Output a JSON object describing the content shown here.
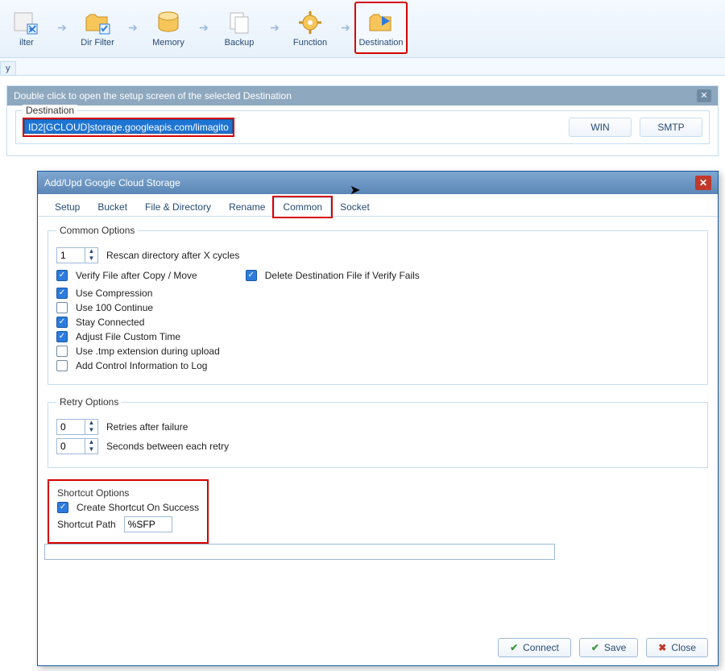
{
  "toolbar": {
    "items": [
      {
        "label": "ilter",
        "name": "filter"
      },
      {
        "label": "Dir Filter",
        "name": "dir-filter"
      },
      {
        "label": "Memory",
        "name": "memory"
      },
      {
        "label": "Backup",
        "name": "backup"
      },
      {
        "label": "Function",
        "name": "function"
      },
      {
        "label": "Destination",
        "name": "destination"
      }
    ]
  },
  "minitab": "y",
  "outerPanel": {
    "title": "Double click to open the setup screen of the selected Destination",
    "fieldsetLabel": "Destination",
    "selectedDest": "ID2[GCLOUD]storage.googleapis.com/limagito",
    "btnWin": "WIN",
    "btnSmtp": "SMTP"
  },
  "dialog": {
    "title": "Add/Upd Google Cloud Storage",
    "tabs": [
      "Setup",
      "Bucket",
      "File & Directory",
      "Rename",
      "Common",
      "Socket"
    ],
    "activeTab": "Common",
    "common": {
      "groupLabel": "Common Options",
      "rescanCycles": "1",
      "rescanLabel": "Rescan directory after X cycles",
      "verifyAfterCopy": {
        "checked": true,
        "label": "Verify File after Copy / Move"
      },
      "deleteIfVerifyFails": {
        "checked": true,
        "label": "Delete Destination File if Verify Fails"
      },
      "useCompression": {
        "checked": true,
        "label": "Use Compression"
      },
      "use100Continue": {
        "checked": false,
        "label": "Use 100 Continue"
      },
      "stayConnected": {
        "checked": true,
        "label": "Stay Connected"
      },
      "adjustFileCustomTime": {
        "checked": true,
        "label": "Adjust File Custom Time"
      },
      "useTmpExt": {
        "checked": false,
        "label": "Use .tmp extension during upload"
      },
      "addCtrlInfo": {
        "checked": false,
        "label": "Add Control Information to Log"
      }
    },
    "retry": {
      "groupLabel": "Retry Options",
      "retries": "0",
      "retriesLabel": "Retries after failure",
      "seconds": "0",
      "secondsLabel": "Seconds between each retry"
    },
    "shortcut": {
      "groupLabel": "Shortcut Options",
      "createOnSuccess": {
        "checked": true,
        "label": "Create Shortcut On Success"
      },
      "pathLabel": "Shortcut Path",
      "pathValue": "%SFP"
    },
    "buttons": {
      "connect": "Connect",
      "save": "Save",
      "close": "Close"
    }
  }
}
